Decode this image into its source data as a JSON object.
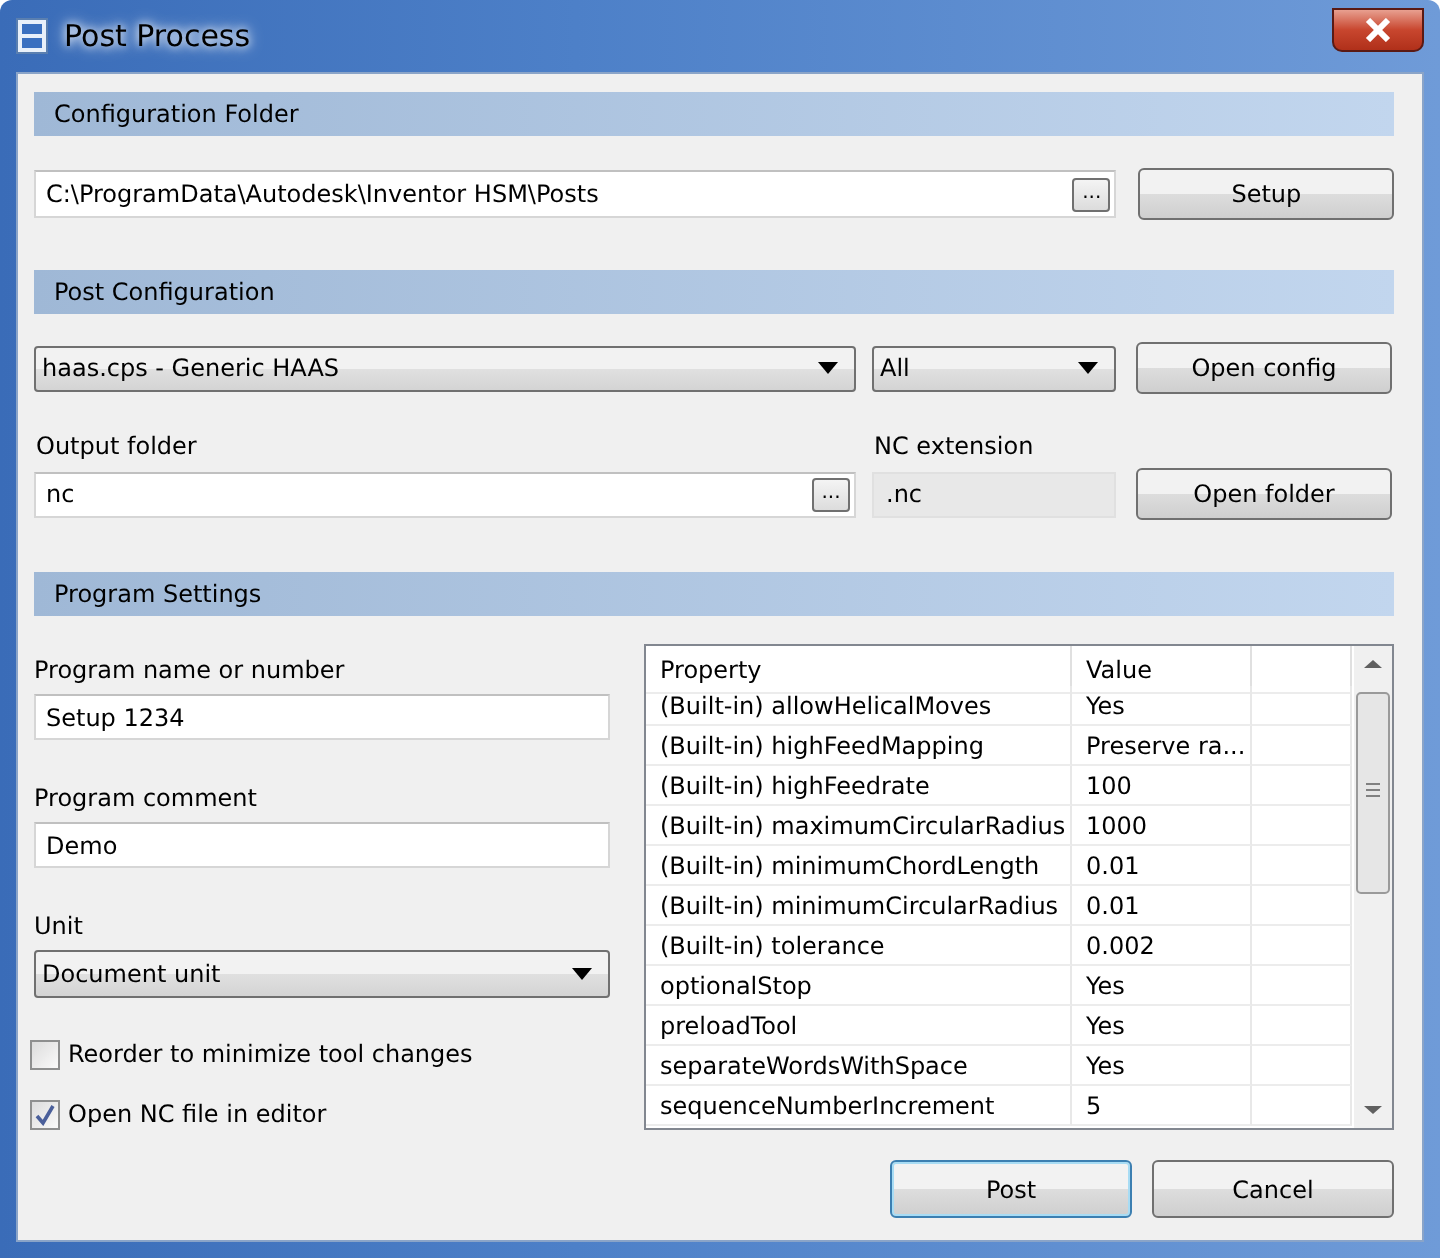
{
  "window": {
    "title": "Post Process"
  },
  "configuration_folder": {
    "header": "Configuration Folder",
    "path": "C:\\ProgramData\\Autodesk\\Inventor HSM\\Posts",
    "browse": "...",
    "setup_button": "Setup"
  },
  "post_configuration": {
    "header": "Post Configuration",
    "post": "haas.cps - Generic HAAS",
    "filter": "All",
    "open_config_button": "Open config",
    "output_folder_label": "Output folder",
    "output_folder": "nc",
    "browse": "...",
    "nc_extension_label": "NC extension",
    "nc_extension": ".nc",
    "open_folder_button": "Open folder"
  },
  "program_settings": {
    "header": "Program Settings",
    "fields": [
      {
        "label": "Program name or number",
        "value": "Setup 1234"
      },
      {
        "label": "Program comment",
        "value": "Demo"
      }
    ],
    "unit_label": "Unit",
    "unit": "Document unit",
    "checkboxes": [
      {
        "label": "Reorder to minimize tool changes",
        "checked": false
      },
      {
        "label": "Open NC file in editor",
        "checked": true
      }
    ],
    "table": {
      "columns": [
        "Property",
        "Value"
      ],
      "rows": [
        [
          "(Built-in) allowHelicalMoves",
          "Yes"
        ],
        [
          "(Built-in) highFeedMapping",
          "Preserve ra..."
        ],
        [
          "(Built-in) highFeedrate",
          "100"
        ],
        [
          "(Built-in) maximumCircularRadius",
          "1000"
        ],
        [
          "(Built-in) minimumChordLength",
          "0.01"
        ],
        [
          "(Built-in) minimumCircularRadius",
          "0.01"
        ],
        [
          "(Built-in) tolerance",
          "0.002"
        ],
        [
          "optionalStop",
          "Yes"
        ],
        [
          "preloadTool",
          "Yes"
        ],
        [
          "separateWordsWithSpace",
          "Yes"
        ],
        [
          "sequenceNumberIncrement",
          "5"
        ]
      ]
    }
  },
  "buttons": [
    "Post",
    "Cancel"
  ]
}
